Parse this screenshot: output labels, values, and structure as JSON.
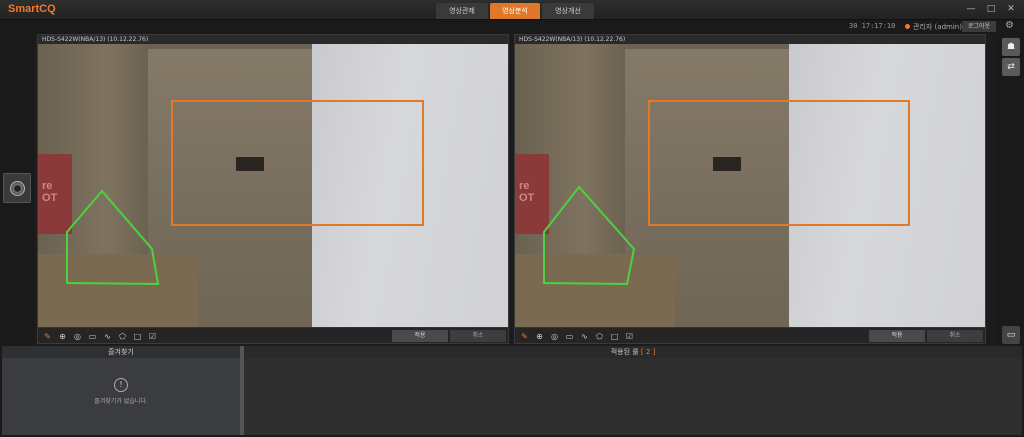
{
  "app": {
    "title": "SmartCQ"
  },
  "tabs": [
    {
      "label": "영상관제",
      "active": false
    },
    {
      "label": "영상분석",
      "active": true
    },
    {
      "label": "영상개선",
      "active": false
    }
  ],
  "window_controls": {
    "minimize": "—",
    "maximize": "□",
    "close": "✕"
  },
  "status": {
    "time": "30  17:17:10",
    "user": "관리자 (admin)",
    "logout": "로그아웃"
  },
  "panels": [
    {
      "title": "HDS-S422W(NBA/13) (10.12.22.76)",
      "apply_label": "적용",
      "cancel_label": "취소"
    },
    {
      "title": "HDS-S422W(NBA/13) (10.12.22.76)",
      "apply_label": "적용",
      "cancel_label": "취소"
    }
  ],
  "video_text": {
    "red_label": "re\nOT"
  },
  "icons": [
    "pin-icon",
    "zoom-icon",
    "eye-icon",
    "rectangle-icon",
    "line-icon",
    "pentagon-icon",
    "square-icon",
    "checkbox-icon"
  ],
  "colors": {
    "accent": "#f07a2a",
    "roi_orange": "#e07a2a",
    "polygon_green": "#4cd23c"
  },
  "favorites": {
    "header": "즐겨찾기",
    "empty_text": "즐겨찾기가 없습니다."
  },
  "rules": {
    "header": "적용된 룰",
    "count": "[ 2 ]"
  }
}
